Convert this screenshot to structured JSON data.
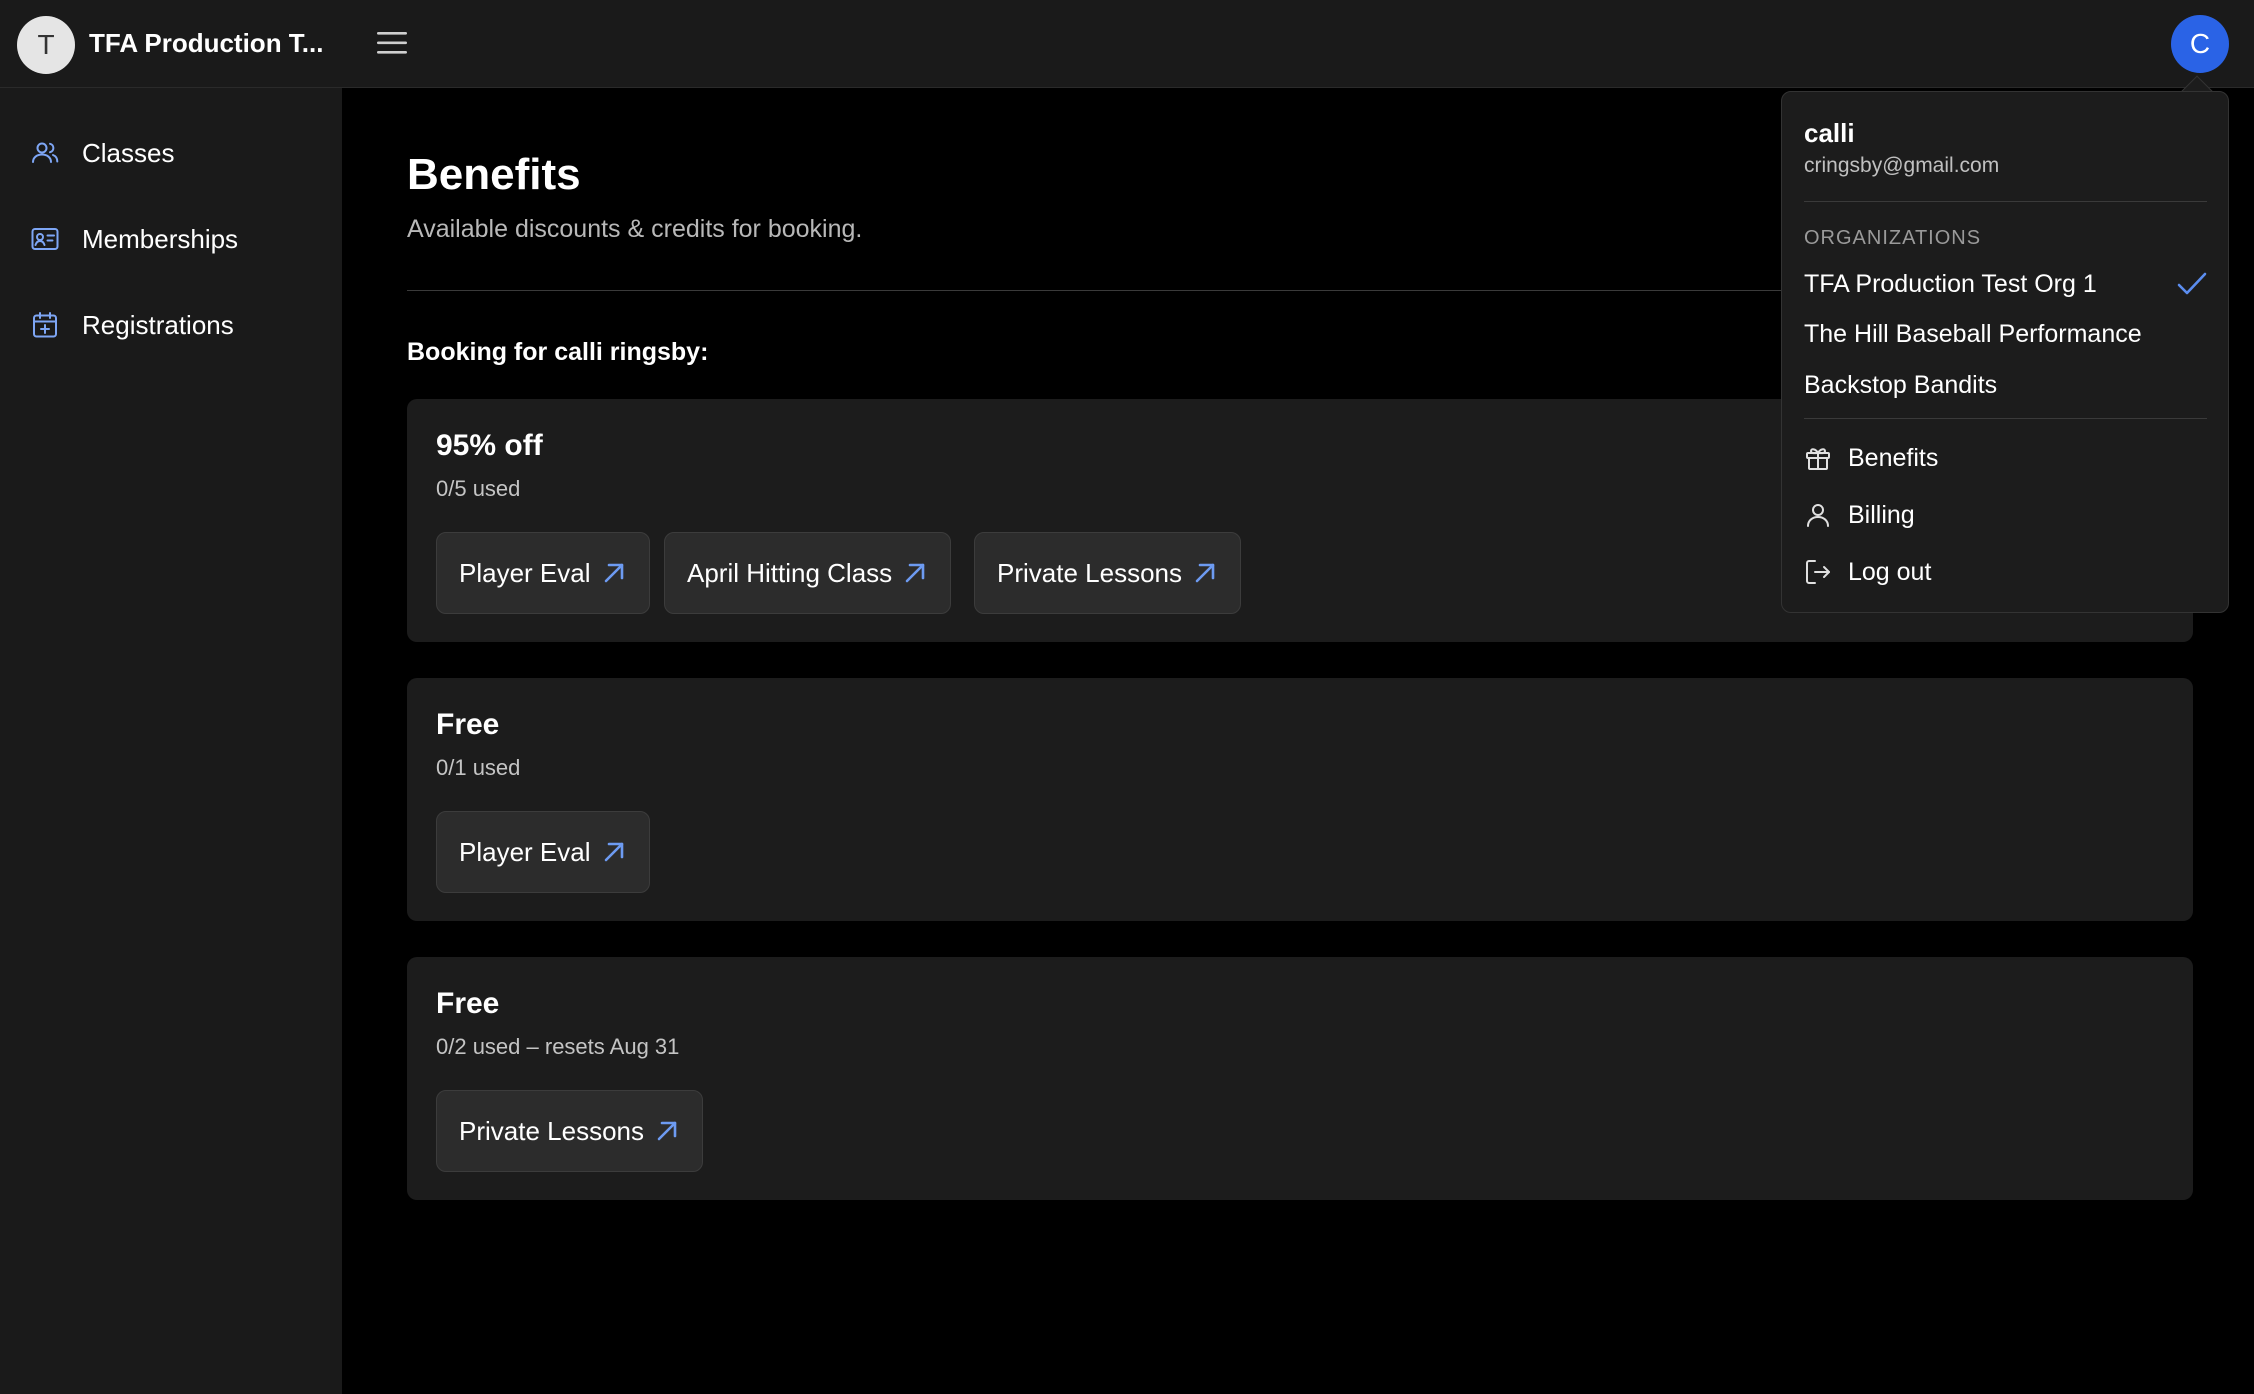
{
  "header": {
    "org_avatar_letter": "T",
    "org_name": "TFA Production T...",
    "menu_icon": "hamburger-menu-icon",
    "user_avatar_letter": "C",
    "user_avatar_color": "#2a63e6"
  },
  "sidebar": {
    "items": [
      {
        "label": "Classes",
        "icon": "users-icon"
      },
      {
        "label": "Memberships",
        "icon": "id-card-icon"
      },
      {
        "label": "Registrations",
        "icon": "calendar-plus-icon"
      }
    ]
  },
  "main": {
    "title": "Benefits",
    "subtitle": "Available discounts & credits for booking.",
    "booking_for": "Booking for calli ringsby:",
    "benefits": [
      {
        "title": "95% off",
        "usage": "0/5 used",
        "links": [
          "Player Eval",
          "April Hitting Class",
          "Private Lessons"
        ]
      },
      {
        "title": "Free",
        "usage": "0/1 used",
        "links": [
          "Player Eval"
        ]
      },
      {
        "title": "Free",
        "usage": "0/2 used – resets Aug 31",
        "links": [
          "Private Lessons"
        ]
      }
    ]
  },
  "user_menu": {
    "username": "calli",
    "email": "cringsby@gmail.com",
    "organizations_heading": "ORGANIZATIONS",
    "organizations": [
      {
        "name": "TFA Production Test Org 1",
        "selected": true
      },
      {
        "name": "The Hill Baseball Performance",
        "selected": false
      },
      {
        "name": "Backstop Bandits",
        "selected": false
      }
    ],
    "actions": [
      {
        "label": "Benefits",
        "icon": "gift-icon"
      },
      {
        "label": "Billing",
        "icon": "user-icon"
      },
      {
        "label": "Log out",
        "icon": "log-out-icon"
      }
    ],
    "accent_color": "#5b8def"
  }
}
